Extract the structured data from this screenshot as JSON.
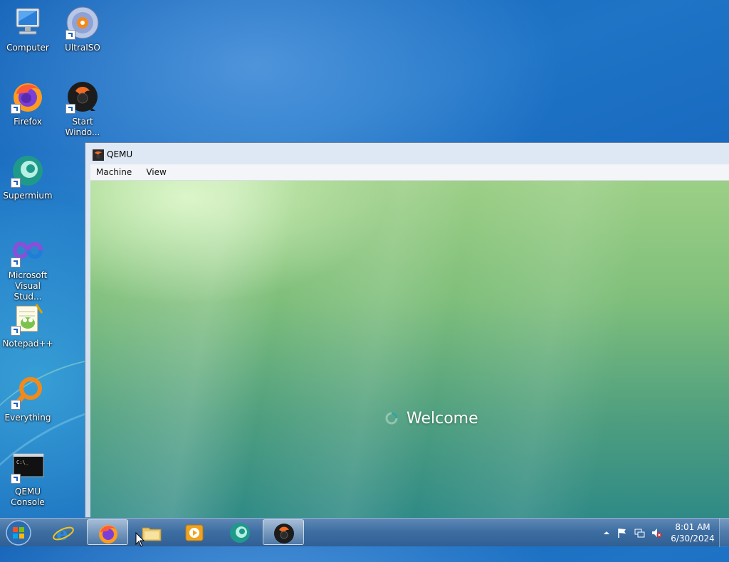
{
  "desktop": {
    "icons": [
      {
        "label": "Computer",
        "icon": "computer-icon"
      },
      {
        "label": "UltraISO",
        "icon": "ultraiso-icon"
      },
      {
        "label": "Firefox",
        "icon": "firefox-icon"
      },
      {
        "label": "Start Windo...",
        "icon": "qemu-icon"
      },
      {
        "label": "Supermium",
        "icon": "supermium-icon"
      },
      {
        "label": "Microsoft Visual Stud...",
        "icon": "visual-studio-icon"
      },
      {
        "label": "Notepad++",
        "icon": "notepad-plus-plus-icon"
      },
      {
        "label": "Everything",
        "icon": "everything-search-icon"
      },
      {
        "label": "QEMU Console",
        "icon": "console-icon"
      }
    ]
  },
  "window": {
    "title": "QEMU",
    "menu": [
      "Machine",
      "View"
    ],
    "guest": {
      "status_text": "Welcome"
    }
  },
  "taskbar": {
    "pinned": [
      {
        "name": "internet-explorer",
        "icon": "internet-explorer-icon",
        "active": false
      },
      {
        "name": "firefox",
        "icon": "firefox-icon",
        "active": true
      },
      {
        "name": "file-explorer",
        "icon": "folder-icon",
        "active": false
      },
      {
        "name": "media-player",
        "icon": "media-player-icon",
        "active": false
      },
      {
        "name": "supermium",
        "icon": "supermium-icon",
        "active": false
      },
      {
        "name": "qemu",
        "icon": "qemu-icon",
        "active": true
      }
    ],
    "clock": {
      "time": "8:01 AM",
      "date": "6/30/2024"
    }
  },
  "colors": {
    "desktop_blue": "#1566bd",
    "taskbar": "#3e6fa3",
    "guest_green": "#7fbf7b"
  }
}
